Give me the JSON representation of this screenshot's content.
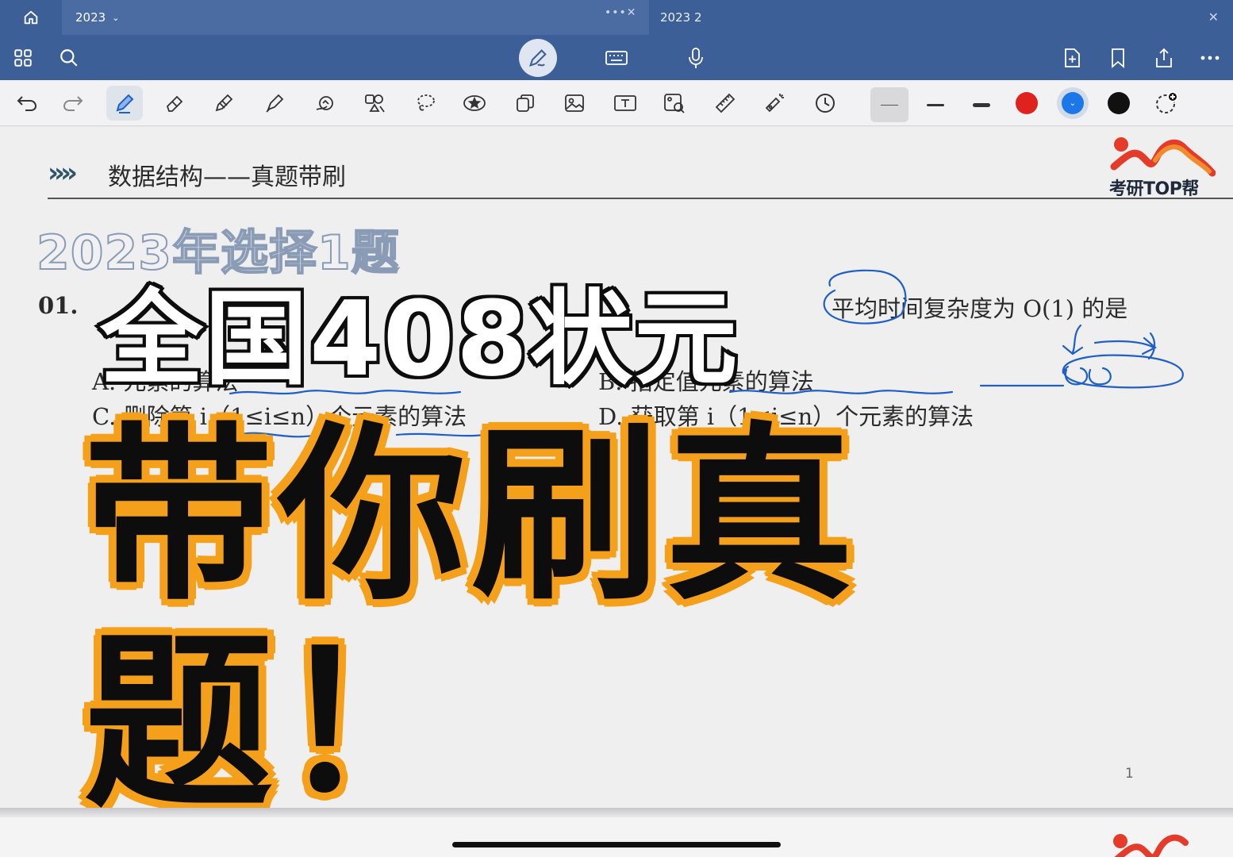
{
  "tabs": {
    "home_icon": "home-icon",
    "active_tab": "2023",
    "second_tab": "2023 2"
  },
  "toolbar": {
    "left_icons": [
      "grid-icon",
      "search-icon"
    ],
    "center_icons": [
      "pen-mode-icon",
      "keyboard-icon",
      "microphone-icon"
    ],
    "right_icons": [
      "add-page-icon",
      "bookmark-icon",
      "share-icon",
      "more-icon"
    ]
  },
  "tools": {
    "items": [
      "undo",
      "redo",
      "pen",
      "eraser",
      "pencil",
      "highlighter",
      "shape",
      "elements",
      "lasso",
      "sticker",
      "copy",
      "image",
      "text",
      "scan",
      "ruler",
      "laser",
      "history"
    ],
    "colors": [
      "#e0221f",
      "#1c78e8",
      "#111111"
    ]
  },
  "document": {
    "header_arrows": "»»",
    "header_title": "数据结构——真题带刷",
    "logo_text": "考研TOP帮",
    "outline_title": "2023年选择1题",
    "question_number": "01.",
    "question_tail": "平均时间复杂度为 O(1) 的是",
    "option_a": "A.               元素的算法",
    "option_b": "B.               指定值元素的算法",
    "option_c": "C. 删除第 i（1≤i≤n）个元素的算法",
    "option_d": "D. 获取第 i（1≤i≤n）个元素的算法",
    "page_number": "1"
  },
  "overlay": {
    "line1": "全国408状元",
    "line2": "带你刷真题！"
  }
}
